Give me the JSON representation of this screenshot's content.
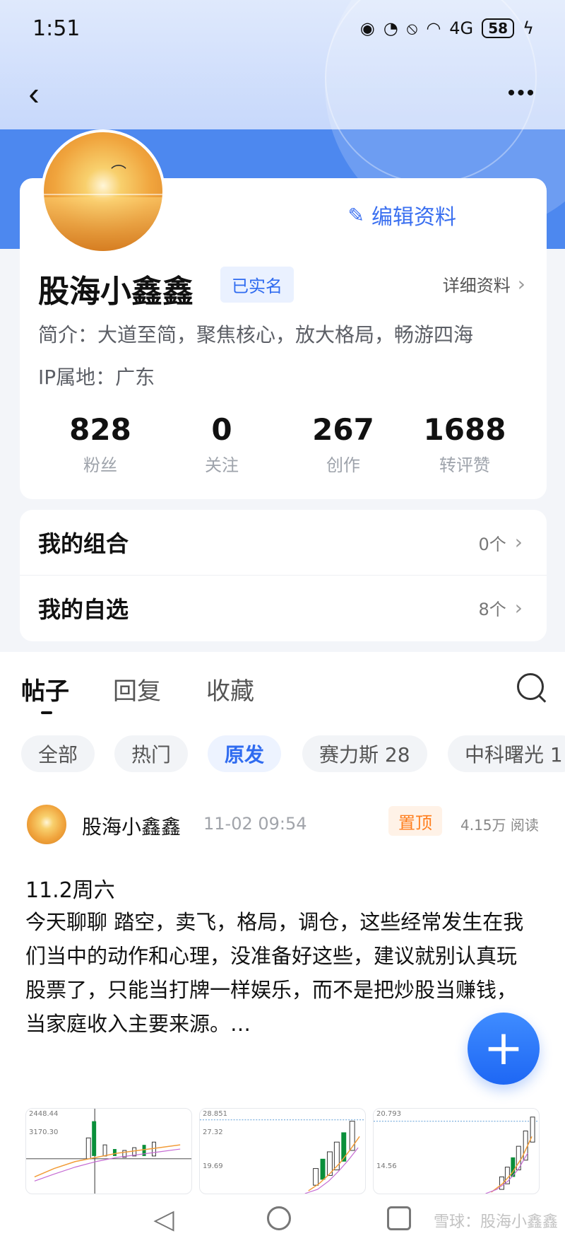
{
  "status_bar": {
    "time": "1:51",
    "battery": "58",
    "signal_text": "4G"
  },
  "header": {
    "back_icon": "chevron-left-icon",
    "more_icon": "more-horizontal-icon"
  },
  "profile": {
    "name": "股海小鑫鑫",
    "verified": "已实名",
    "detail_link": "详细资料",
    "edit_button": "编辑资料",
    "bio": "简介：大道至简，聚焦核心，放大格局，畅游四海",
    "ip": "IP属地：广东",
    "stats": [
      {
        "value": "828",
        "label": "粉丝"
      },
      {
        "value": "0",
        "label": "关注"
      },
      {
        "value": "267",
        "label": "创作"
      },
      {
        "value": "1688",
        "label": "转评赞"
      }
    ]
  },
  "my_sections": [
    {
      "title": "我的组合",
      "value": "0个"
    },
    {
      "title": "我的自选",
      "value": "8个"
    }
  ],
  "tabs": [
    {
      "label": "帖子"
    },
    {
      "label": "回复"
    },
    {
      "label": "收藏"
    }
  ],
  "filters": [
    {
      "label": "全部"
    },
    {
      "label": "热门"
    },
    {
      "label": "原发"
    },
    {
      "label": "赛力斯 28"
    },
    {
      "label": "中科曙光 1"
    }
  ],
  "post": {
    "author": "股海小鑫鑫",
    "time": "11-02 09:54",
    "pinned": "置顶",
    "reads": "4.15万 阅读",
    "title": "11.2周六",
    "body": "今天聊聊 踏空，卖飞，格局，调仓，这些经常发生在我们当中的动作和心理，没准备好这些，建议就别认真玩股票了，只能当打牌一样娱乐，而不是把炒股当赚钱，当家庭收入主要来源。…"
  },
  "thumbnails": [
    {
      "label_top": "2448.44",
      "label_mid": "3170.30",
      "label_low": ""
    },
    {
      "label_top": "28.851",
      "label_mid": "27.32",
      "label_low": "19.69"
    },
    {
      "label_top": "20.793",
      "label_mid": "",
      "label_low": "14.56"
    }
  ],
  "system_nav": {
    "watermark": "雪球：股海小鑫鑫"
  }
}
